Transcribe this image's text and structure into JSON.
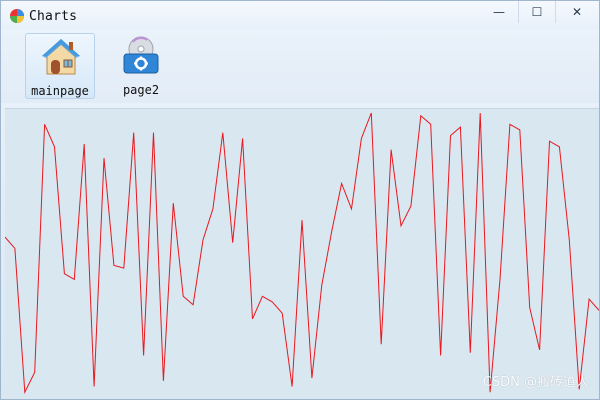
{
  "window": {
    "title": "Charts",
    "controls": {
      "minimize": "—",
      "maximize": "☐",
      "close": "✕"
    }
  },
  "toolbar": {
    "items": [
      {
        "label": "mainpage",
        "icon": "home-icon",
        "active": true
      },
      {
        "label": "page2",
        "icon": "settings-disc-icon",
        "active": false
      }
    ]
  },
  "chart_data": {
    "type": "line",
    "color": "#e8181e",
    "grid": false,
    "legend": "none",
    "ylim": [
      0,
      100
    ],
    "values": [
      56,
      52,
      1,
      8,
      96,
      88,
      43,
      41,
      89,
      3,
      84,
      46,
      45,
      93,
      14,
      93,
      5,
      68,
      35,
      32,
      55,
      66,
      93,
      54,
      91,
      27,
      35,
      33,
      29,
      3,
      62,
      6,
      39,
      58,
      75,
      66,
      91,
      100,
      18,
      87,
      60,
      67,
      99,
      96,
      14,
      92,
      95,
      15,
      100,
      1,
      41,
      96,
      94,
      31,
      16,
      90,
      88,
      55,
      2,
      34,
      30
    ]
  },
  "watermark": "CSDN @搬砖道人"
}
